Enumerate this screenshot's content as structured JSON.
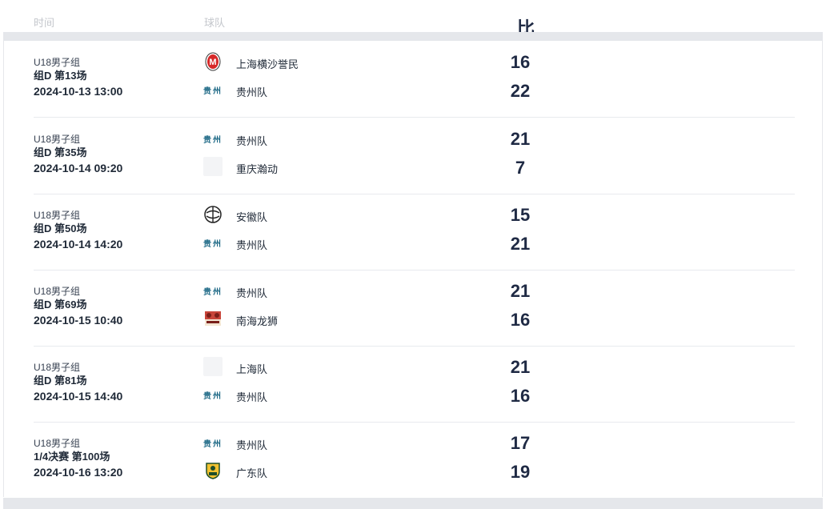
{
  "header": {
    "time": "时间",
    "team": "球队",
    "score": "比分"
  },
  "matches": [
    {
      "category": "U18男子组",
      "round": "组D 第13场",
      "datetime": "2024-10-13 13:00",
      "team1": {
        "name": "上海横沙誉民",
        "logo": "red-m-logo",
        "score": "16"
      },
      "team2": {
        "name": "贵州队",
        "logo": "guizhou-text-logo",
        "logo_text": "贵州",
        "score": "22"
      }
    },
    {
      "category": "U18男子组",
      "round": "组D 第35场",
      "datetime": "2024-10-14 09:20",
      "team1": {
        "name": "贵州队",
        "logo": "guizhou-text-logo",
        "logo_text": "贵州",
        "score": "21"
      },
      "team2": {
        "name": "重庆瀚动",
        "logo": "placeholder-logo",
        "score": "7"
      }
    },
    {
      "category": "U18男子组",
      "round": "组D 第50场",
      "datetime": "2024-10-14 14:20",
      "team1": {
        "name": "安徽队",
        "logo": "ball-logo",
        "score": "15"
      },
      "team2": {
        "name": "贵州队",
        "logo": "guizhou-text-logo",
        "logo_text": "贵州",
        "score": "21"
      }
    },
    {
      "category": "U18男子组",
      "round": "组D 第69场",
      "datetime": "2024-10-15 10:40",
      "team1": {
        "name": "贵州队",
        "logo": "guizhou-text-logo",
        "logo_text": "贵州",
        "score": "21"
      },
      "team2": {
        "name": "南海龙狮",
        "logo": "lion-logo",
        "score": "16"
      }
    },
    {
      "category": "U18男子组",
      "round": "组D 第81场",
      "datetime": "2024-10-15 14:40",
      "team1": {
        "name": "上海队",
        "logo": "placeholder-logo",
        "score": "21"
      },
      "team2": {
        "name": "贵州队",
        "logo": "guizhou-text-logo",
        "logo_text": "贵州",
        "score": "16"
      }
    },
    {
      "category": "U18男子组",
      "round": "1/4决赛 第100场",
      "datetime": "2024-10-16 13:20",
      "team1": {
        "name": "贵州队",
        "logo": "guizhou-text-logo",
        "logo_text": "贵州",
        "score": "17"
      },
      "team2": {
        "name": "广东队",
        "logo": "shield-logo",
        "score": "19"
      }
    }
  ]
}
